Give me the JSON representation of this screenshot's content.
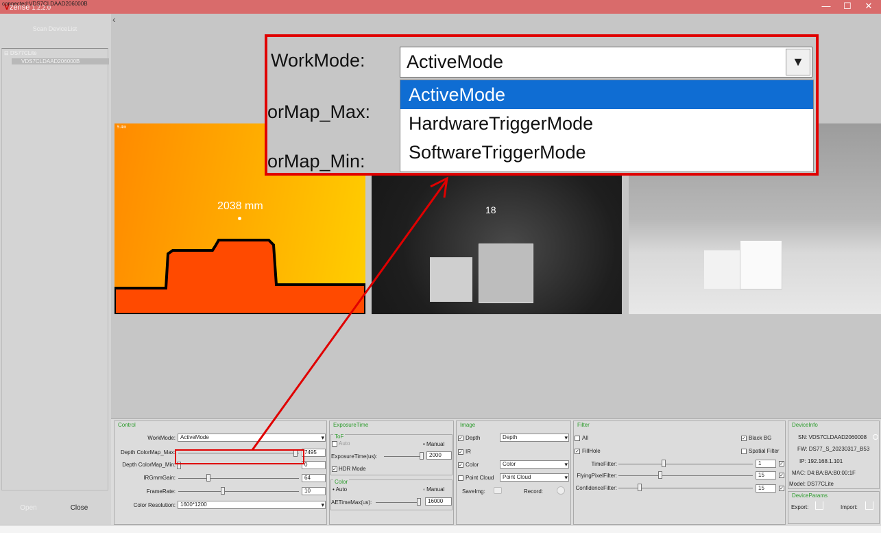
{
  "app": {
    "brand": "V",
    "title": "zense",
    "version": "1.2.2.0"
  },
  "window": {
    "min": "—",
    "max": "☐",
    "close": "✕"
  },
  "sidebar": {
    "scan": "Scan DeviceList",
    "tree_root": "⊟ DS77CLite",
    "tree_device": "VDS7CLDAAD206000B",
    "open": "Open",
    "close": "Close"
  },
  "status": "connected:VDS7CLDAAD206000B",
  "views": {
    "depth_label": "2038  mm",
    "depth_tag": "5.4m",
    "ir_label": "18"
  },
  "zoom": {
    "workmode_label": "WorkMode:",
    "colormap_max_label": "orMap_Max:",
    "colormap_min_label": "orMap_Min:",
    "selected": "ActiveMode",
    "options": [
      "ActiveMode",
      "HardwareTriggerMode",
      "SoftwareTriggerMode"
    ]
  },
  "control": {
    "title": "Control",
    "workmode_label": "WorkMode:",
    "workmode_value": "ActiveMode",
    "depth_max_label": "Depth ColorMap_Max:",
    "depth_max_value": "7495",
    "depth_min_label": "Depth ColorMap_Min:",
    "depth_min_value": "0",
    "irgain_label": "IRGmmGain:",
    "irgain_value": "64",
    "framerate_label": "FrameRate:",
    "framerate_value": "10",
    "colorres_label": "Color Resolution:",
    "colorres_value": "1600*1200"
  },
  "exposure": {
    "title": "ExposureTime",
    "tof_title": "ToF",
    "auto": "Auto",
    "manual": "Manual",
    "exposure_label": "ExposureTime(us):",
    "exposure_value": "2000",
    "hdr": "HDR Mode",
    "color_title": "Color",
    "color_auto": "Auto",
    "color_manual": "Manual",
    "ae_label": "AETimeMax(us):",
    "ae_value": "16000"
  },
  "image": {
    "title": "Image",
    "depth": "Depth",
    "depth_dd": "Depth",
    "ir": "IR",
    "color": "Color",
    "color_dd": "Color",
    "pc": "Point Cloud",
    "pc_dd": "Point Cloud",
    "saveimg": "SaveImg:",
    "record": "Record:"
  },
  "filter": {
    "title": "Filter",
    "all": "All",
    "blackbg": "Black BG",
    "fillhole": "FillHole",
    "spatial": "Spatial Filter",
    "time_label": "TimeFilter:",
    "time_value": "1",
    "flying_label": "FlyingPixelFilter:",
    "flying_value": "15",
    "conf_label": "ConfidenceFilter:",
    "conf_value": "15"
  },
  "device": {
    "title": "DeviceInfo",
    "sn": "SN:  VDS7CLDAAD2060008",
    "fw": "FW:  DS77_S_20230317_B53",
    "ip": "IP:  192.168.1.101",
    "mac": "MAC:  D4:BA:BA:B0:00:1F",
    "model": "Model:  DS77CLite",
    "params_title": "DeviceParams",
    "export": "Export:",
    "import": "Import:"
  },
  "colors": {
    "accent": "#e00000",
    "select": "#0f6dd3",
    "titlebar": "#d96b6b",
    "group_title": "#2a9b2a"
  }
}
